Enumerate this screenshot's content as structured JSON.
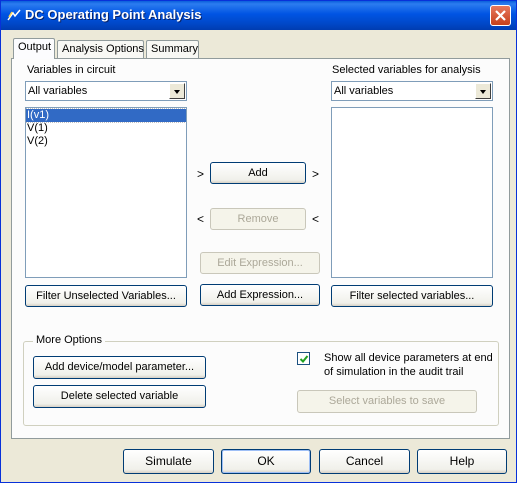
{
  "window": {
    "title": "DC Operating Point Analysis",
    "icon": "app-icon",
    "close_icon": "close-icon"
  },
  "tabs": [
    {
      "label": "Output",
      "active": true
    },
    {
      "label": "Analysis Options",
      "active": false
    },
    {
      "label": "Summary",
      "active": false
    }
  ],
  "output": {
    "left": {
      "label": "Variables in circuit",
      "filter_value": "All variables",
      "items": [
        {
          "label": "I(v1)",
          "selected": true
        },
        {
          "label": "V(1)",
          "selected": false
        },
        {
          "label": "V(2)",
          "selected": false
        }
      ],
      "filter_button": "Filter Unselected Variables..."
    },
    "right": {
      "label": "Selected variables for analysis",
      "filter_value": "All variables",
      "items": [],
      "filter_button": "Filter selected variables..."
    },
    "middle": {
      "add": "Add",
      "remove": "Remove",
      "edit_expression": "Edit Expression...",
      "add_expression": "Add Expression...",
      "chev_right": ">",
      "chev_left": "<"
    },
    "more_options": {
      "title": "More Options",
      "add_param_button": "Add device/model parameter...",
      "delete_var_button": "Delete selected variable",
      "show_all_label_line1": "Show all device parameters at end",
      "show_all_label_line2": "of simulation in the audit trail",
      "show_all_checked": true,
      "select_vars_button": "Select variables to save"
    }
  },
  "footer": {
    "simulate": "Simulate",
    "ok": "OK",
    "cancel": "Cancel",
    "help": "Help"
  }
}
